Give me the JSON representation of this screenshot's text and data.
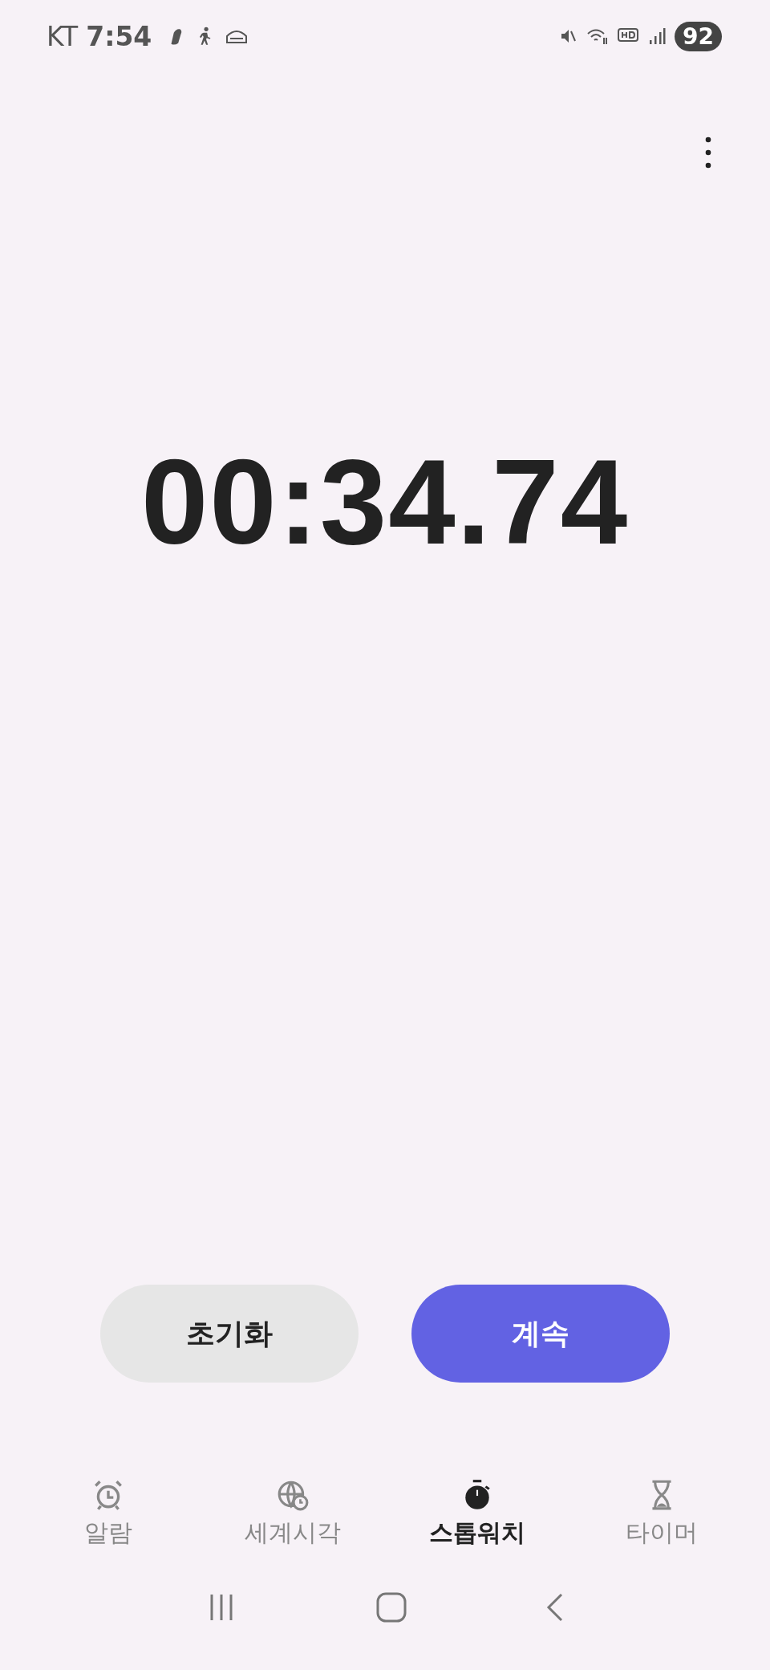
{
  "status_bar": {
    "carrier": "KT",
    "time": "7:54",
    "battery": "92"
  },
  "stopwatch": {
    "elapsed": "00:34.74"
  },
  "buttons": [
    {
      "label": "초기화",
      "kind": "secondary"
    },
    {
      "label": "계속",
      "kind": "primary"
    }
  ],
  "tabs": [
    {
      "label": "알람",
      "kind": "alarm",
      "selected": false
    },
    {
      "label": "세계시각",
      "kind": "world",
      "selected": false
    },
    {
      "label": "스톱워치",
      "kind": "stopwatch",
      "selected": true
    },
    {
      "label": "타이머",
      "kind": "timer",
      "selected": false
    }
  ]
}
